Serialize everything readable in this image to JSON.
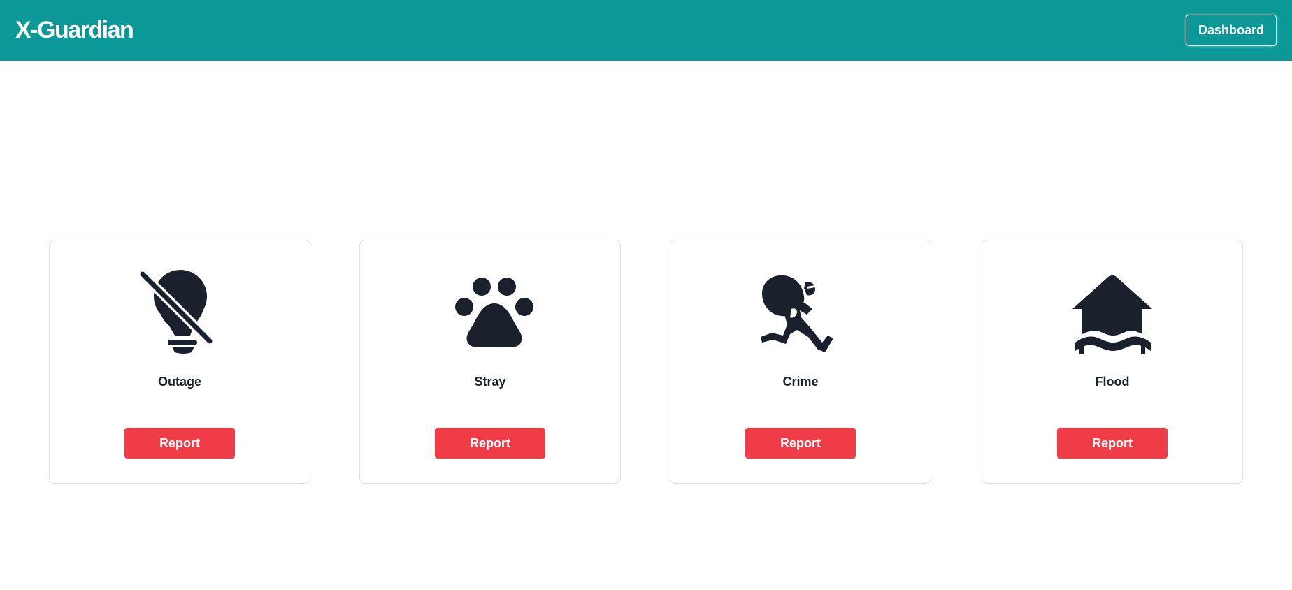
{
  "header": {
    "brand": "X-Guardian",
    "dashboard_label": "Dashboard",
    "background_color": "#0d9898"
  },
  "cards": [
    {
      "title": "Outage",
      "icon": "lightbulb-slash-icon",
      "button_label": "Report"
    },
    {
      "title": "Stray",
      "icon": "paw-icon",
      "button_label": "Report"
    },
    {
      "title": "Crime",
      "icon": "thief-running-icon",
      "button_label": "Report"
    },
    {
      "title": "Flood",
      "icon": "house-flood-icon",
      "button_label": "Report"
    }
  ],
  "colors": {
    "report_button": "#f03c47",
    "icon": "#1a202c"
  }
}
